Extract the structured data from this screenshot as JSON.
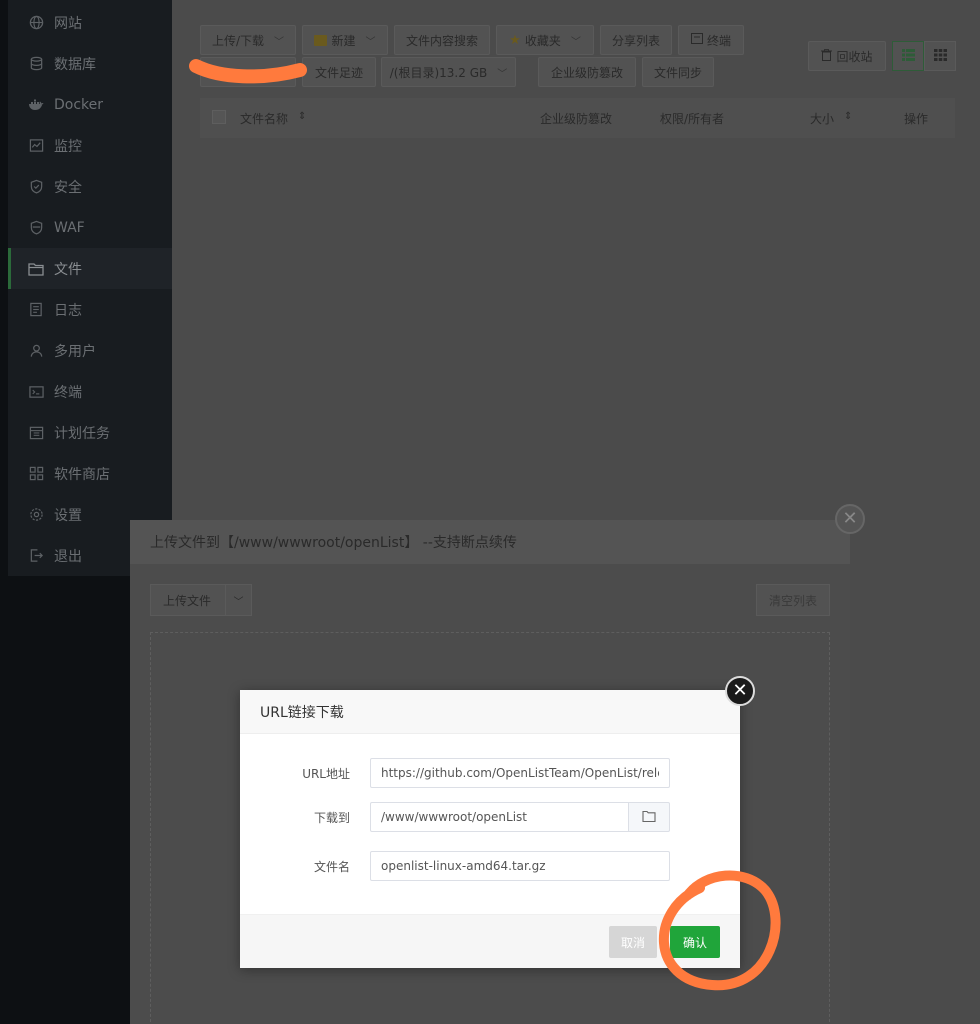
{
  "sidebar": {
    "items": [
      {
        "label": "网站",
        "icon": "globe-icon"
      },
      {
        "label": "数据库",
        "icon": "database-icon"
      },
      {
        "label": "Docker",
        "icon": "docker-icon"
      },
      {
        "label": "监控",
        "icon": "monitor-icon"
      },
      {
        "label": "安全",
        "icon": "shield-icon"
      },
      {
        "label": "WAF",
        "icon": "waf-shield-icon"
      },
      {
        "label": "文件",
        "icon": "folder-icon"
      },
      {
        "label": "日志",
        "icon": "log-icon"
      },
      {
        "label": "多用户",
        "icon": "users-icon"
      },
      {
        "label": "终端",
        "icon": "terminal-icon"
      },
      {
        "label": "计划任务",
        "icon": "calendar-icon"
      },
      {
        "label": "软件商店",
        "icon": "apps-icon"
      },
      {
        "label": "设置",
        "icon": "gear-icon"
      },
      {
        "label": "退出",
        "icon": "logout-icon"
      }
    ]
  },
  "toolbar": {
    "upload_download": "上传/下载",
    "new": "新建",
    "content_search": "文件内容搜索",
    "favorites": "收藏夹",
    "share_list": "分享列表",
    "terminal": "终端",
    "file_footprint": "文件足迹",
    "root_dir": "/(根目录)13.2 GB",
    "tamper_proof": "企业级防篡改",
    "file_sync": "文件同步",
    "recycle_bin": "回收站"
  },
  "table": {
    "headers": {
      "name": "文件名称",
      "tamper": "企业级防篡改",
      "perm": "权限/所有者",
      "size": "大小",
      "ops": "操作"
    }
  },
  "upload_dialog": {
    "title": "上传文件到【/www/wwwroot/openList】 --支持断点续传",
    "upload_button": "上传文件",
    "clear_button": "清空列表"
  },
  "url_dialog": {
    "title": "URL链接下载",
    "url_label": "URL地址",
    "url_value": "https://github.com/OpenListTeam/OpenList/relea",
    "dest_label": "下载到",
    "dest_value": "/www/wwwroot/openList",
    "filename_label": "文件名",
    "filename_value": "openlist-linux-amd64.tar.gz",
    "cancel": "取消",
    "confirm": "确认"
  },
  "colors": {
    "accent": "#20a53a",
    "annotation": "#ff7a3d"
  }
}
